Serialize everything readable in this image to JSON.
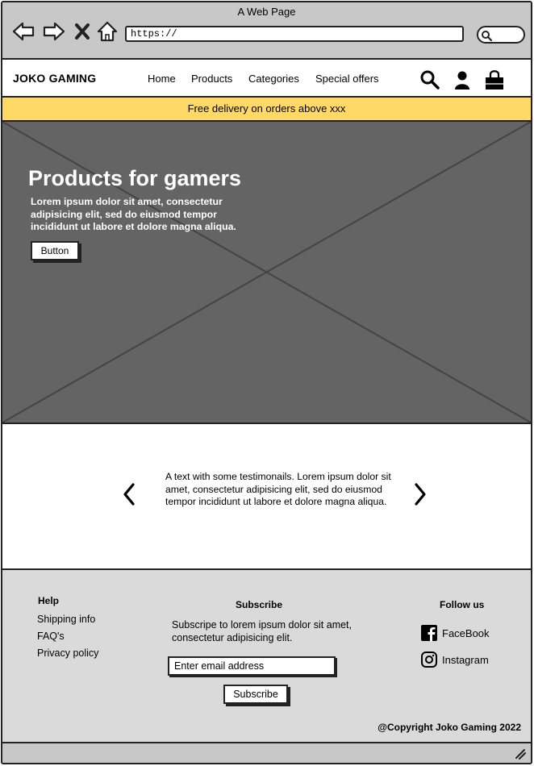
{
  "browser": {
    "title": "A Web Page",
    "url": "https://",
    "icons": [
      "back-arrow-icon",
      "forward-arrow-icon",
      "close-x-icon",
      "home-icon",
      "search-icon"
    ]
  },
  "header": {
    "logo": "JOKO GAMING",
    "nav": [
      "Home",
      "Products",
      "Categories",
      "Special offers"
    ],
    "icons": [
      "search-icon",
      "user-icon",
      "shopping-bag-icon"
    ]
  },
  "promo": {
    "text": "Free delivery on orders above xxx",
    "color": "#ffd966"
  },
  "hero": {
    "title": "Products for gamers",
    "text": "Lorem ipsum dolor sit amet, consectetur adipisicing elit, sed do eiusmod tempor incididunt ut labore et dolore magna aliqua.",
    "button": "Button",
    "color": "#646464"
  },
  "testimonials": {
    "text": "A text with some testimonails. Lorem ipsum dolor sit amet, consectetur adipisicing elit, sed do eiusmod tempor incididunt ut labore et dolore magna aliqua."
  },
  "footer": {
    "help": {
      "heading": "Help",
      "links": [
        "Shipping info",
        "FAQ's",
        "Privacy policy"
      ]
    },
    "subscribe": {
      "heading": "Subscribe",
      "text": "Subscripe to lorem ipsum dolor sit amet, consectetur adipisicing elit.",
      "placeholder": "Enter email address",
      "button": "Subscribe"
    },
    "follow": {
      "heading": "Follow us",
      "links": [
        "FaceBook",
        "Instagram"
      ]
    },
    "copyright": "@Copyright Joko Gaming 2022",
    "color": "#dadada"
  }
}
